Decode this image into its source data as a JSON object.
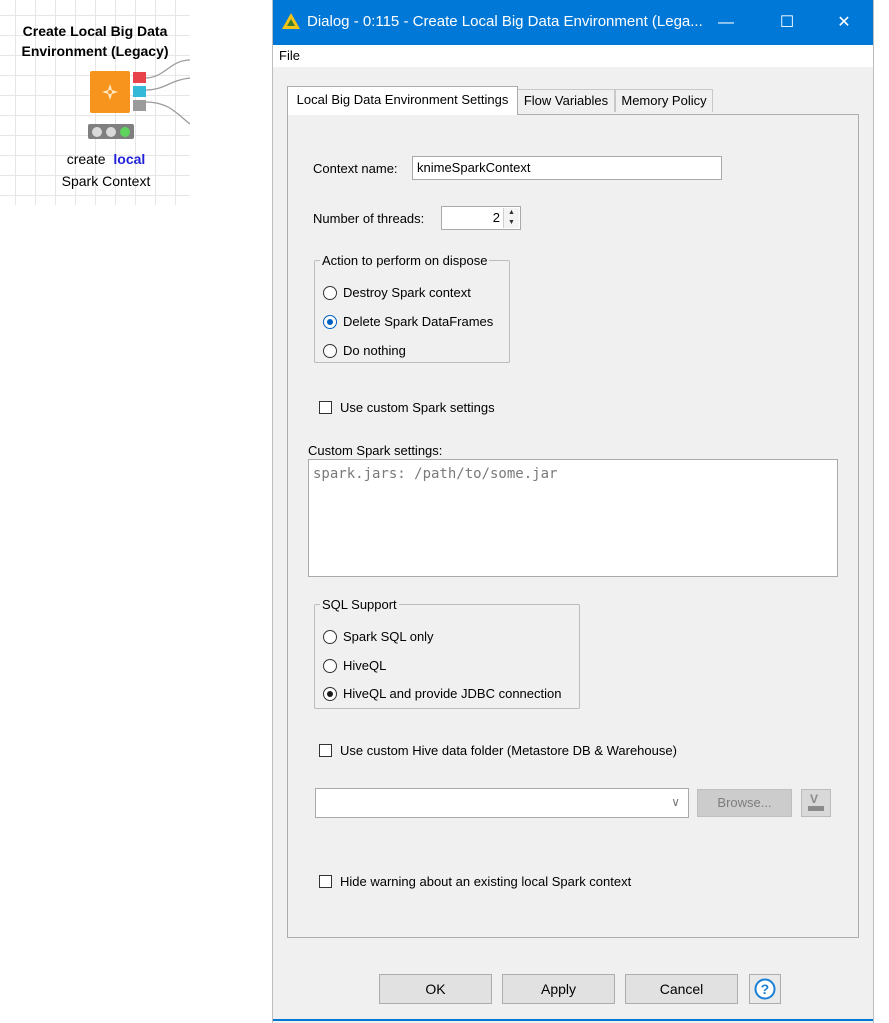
{
  "node": {
    "title_line1": "Create Local Big Data",
    "title_line2": "Environment (Legacy)",
    "label_prefix": "create",
    "label_highlight": "local",
    "label_line2": "Spark Context",
    "icon": "spark-star-icon",
    "color": "#f7941d",
    "status_lights": [
      "gray",
      "gray",
      "green"
    ],
    "ports": [
      "#e8434b",
      "#34b9d9",
      "#9b9b9b"
    ]
  },
  "dialog": {
    "title": "Dialog - 0:115 - Create Local Big Data Environment (Lega...",
    "title_icon": "knime-warning-icon",
    "accent": "#0078d7",
    "controls": {
      "minimize": "—",
      "maximize": "☐",
      "close": "✕"
    },
    "menu": {
      "file": "File"
    },
    "tabs": [
      "Local Big Data Environment Settings",
      "Flow Variables",
      "Memory Policy"
    ],
    "settings": {
      "context_name_label": "Context name:",
      "context_name_value": "knimeSparkContext",
      "threads_label": "Number of threads:",
      "threads_value": "2",
      "dispose_group": {
        "legend": "Action to perform on dispose",
        "options": [
          "Destroy Spark context",
          "Delete Spark DataFrames",
          "Do nothing"
        ],
        "selected": "Delete Spark DataFrames"
      },
      "use_custom_spark_label": "Use custom Spark settings",
      "use_custom_spark_checked": false,
      "custom_spark_label": "Custom Spark settings:",
      "custom_spark_text": "spark.jars: /path/to/some.jar",
      "sql_group": {
        "legend": "SQL Support",
        "options": [
          "Spark SQL only",
          "HiveQL",
          "HiveQL and provide JDBC connection"
        ],
        "selected": "HiveQL and provide JDBC connection"
      },
      "custom_hive_label": "Use custom Hive data folder (Metastore DB & Warehouse)",
      "custom_hive_checked": false,
      "hive_folder_value": "",
      "browse_label": "Browse...",
      "variable_button_icon": "flow-variable-icon",
      "hide_warning_label": "Hide warning about an existing local Spark context",
      "hide_warning_checked": false
    },
    "buttons": {
      "ok": "OK",
      "apply": "Apply",
      "cancel": "Cancel",
      "help_icon": "help-icon"
    }
  }
}
